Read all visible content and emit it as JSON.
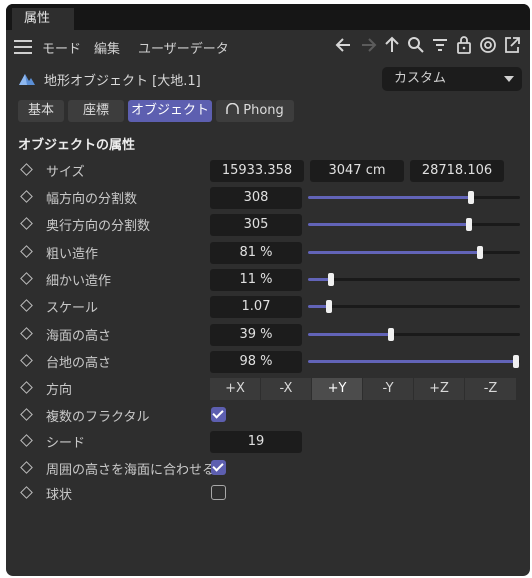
{
  "window": {
    "tab_title": "属性"
  },
  "menubar": {
    "mode": "モード",
    "edit": "編集",
    "userdata": "ユーザーデータ"
  },
  "object": {
    "title": "地形オブジェクト [大地.1]",
    "preset": "カスタム"
  },
  "prop_tabs": [
    {
      "label": "基本",
      "active": false
    },
    {
      "label": "座標",
      "active": false
    },
    {
      "label": "オブジェクト",
      "active": true
    },
    {
      "label": "Phong",
      "active": false
    }
  ],
  "section_title": "オブジェクトの属性",
  "params": {
    "size": {
      "label": "サイズ",
      "x": "15933.358",
      "y": "3047 cm",
      "z": "28718.106"
    },
    "width_seg": {
      "label": "幅方向の分割数",
      "value": "308",
      "slider": 0.77
    },
    "depth_seg": {
      "label": "奥行方向の分割数",
      "value": "305",
      "slider": 0.76
    },
    "rough": {
      "label": "粗い造作",
      "value": "81 %",
      "slider": 0.81
    },
    "fine": {
      "label": "細かい造作",
      "value": "11 %",
      "slider": 0.11
    },
    "scale": {
      "label": "スケール",
      "value": "1.07",
      "slider": 0.1
    },
    "sea": {
      "label": "海面の高さ",
      "value": "39 %",
      "slider": 0.39
    },
    "plateau": {
      "label": "台地の高さ",
      "value": "98 %",
      "slider": 0.98
    },
    "direction": {
      "label": "方向",
      "options": [
        "+X",
        "-X",
        "+Y",
        "-Y",
        "+Z",
        "-Z"
      ],
      "selected": "+Y"
    },
    "multifractal": {
      "label": "複数のフラクタル",
      "checked": true
    },
    "seed": {
      "label": "シード",
      "value": "19"
    },
    "border": {
      "label": "周囲の高さを海面に合わせる",
      "checked": true
    },
    "spherical": {
      "label": "球状",
      "checked": false
    }
  },
  "colors": {
    "accent": "#5d5fb0",
    "panel": "#2e2e2e",
    "field": "#1c1c1c"
  }
}
